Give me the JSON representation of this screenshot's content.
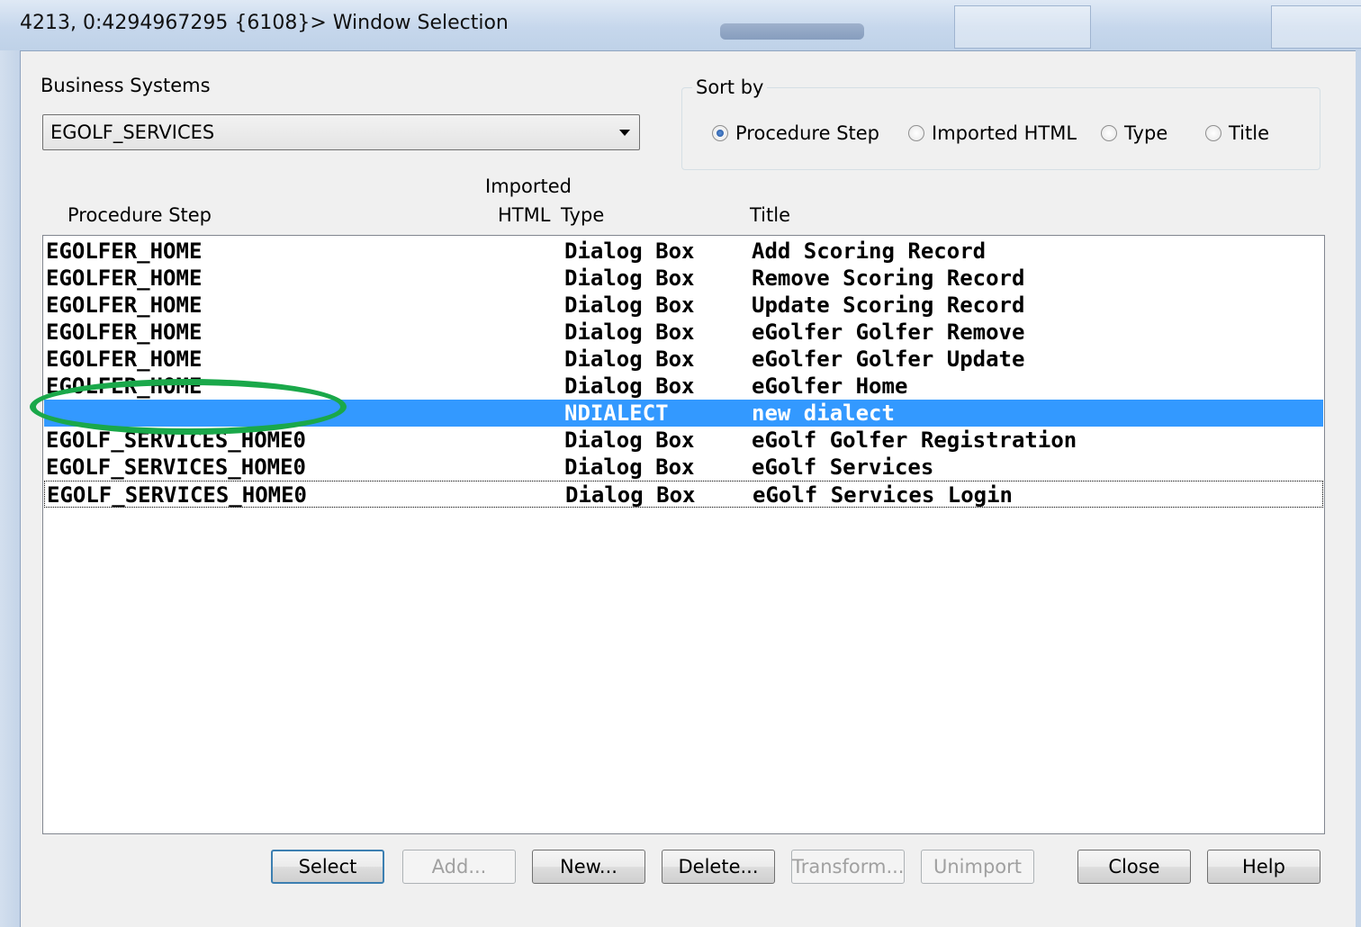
{
  "window": {
    "title": "4213, 0:4294967295 {6108}> Window Selection"
  },
  "business_systems": {
    "label": "Business Systems",
    "selected": "EGOLF_SERVICES"
  },
  "sort_by": {
    "legend": "Sort by",
    "options": [
      {
        "label": "Procedure Step",
        "selected": true
      },
      {
        "label": "Imported HTML",
        "selected": false
      },
      {
        "label": "Type",
        "selected": false
      },
      {
        "label": "Title",
        "selected": false
      }
    ]
  },
  "columns": {
    "procedure_step": "Procedure Step",
    "imported_html_top": "Imported",
    "imported_html_bottom": "HTML",
    "type": "Type",
    "title": "Title"
  },
  "rows": [
    {
      "procedure_step": "EGOLFER_HOME",
      "imported_html": "",
      "type": "Dialog Box",
      "title": "Add Scoring Record"
    },
    {
      "procedure_step": "EGOLFER_HOME",
      "imported_html": "",
      "type": "Dialog Box",
      "title": "Remove Scoring Record"
    },
    {
      "procedure_step": "EGOLFER_HOME",
      "imported_html": "",
      "type": "Dialog Box",
      "title": "Update Scoring Record"
    },
    {
      "procedure_step": "EGOLFER_HOME",
      "imported_html": "",
      "type": "Dialog Box",
      "title": "eGolfer Golfer Remove"
    },
    {
      "procedure_step": "EGOLFER_HOME",
      "imported_html": "",
      "type": "Dialog Box",
      "title": "eGolfer Golfer Update"
    },
    {
      "procedure_step": "EGOLFER_HOME",
      "imported_html": "",
      "type": "Dialog Box",
      "title": "eGolfer Home"
    },
    {
      "procedure_step": "",
      "imported_html": "",
      "type": "NDIALECT",
      "title": "new dialect",
      "selected": true
    },
    {
      "procedure_step": "EGOLF_SERVICES_HOME0",
      "imported_html": "",
      "type": "Dialog Box",
      "title": "eGolf Golfer Registration"
    },
    {
      "procedure_step": "EGOLF_SERVICES_HOME0",
      "imported_html": "",
      "type": "Dialog Box",
      "title": "eGolf Services"
    },
    {
      "procedure_step": "EGOLF_SERVICES_HOME0",
      "imported_html": "",
      "type": "Dialog Box",
      "title": "eGolf Services Login",
      "focused": true
    }
  ],
  "buttons": {
    "select": "Select",
    "add": "Add...",
    "new": "New...",
    "delete": "Delete...",
    "transform": "Transform...",
    "unimport": "Unimport",
    "close": "Close",
    "help": "Help"
  },
  "colors": {
    "selection": "#3399ff",
    "annotation": "#1aa84a",
    "dialog_bg": "#f0f0f0"
  }
}
